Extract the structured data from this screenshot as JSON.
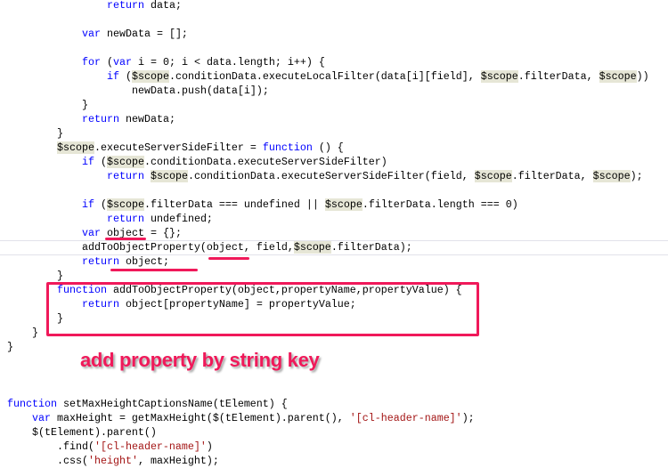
{
  "code_lines": [
    {
      "indent": 16,
      "text": "return data;"
    },
    {
      "indent": 0,
      "text": ""
    },
    {
      "indent": 12,
      "text": "var newData = [];"
    },
    {
      "indent": 0,
      "text": ""
    },
    {
      "indent": 12,
      "text": "for (var i = 0; i < data.length; i++) {"
    },
    {
      "indent": 16,
      "text": "if ($scope.conditionData.executeLocalFilter(data[i][field], $scope.filterData, $scope))"
    },
    {
      "indent": 20,
      "text": "newData.push(data[i]);"
    },
    {
      "indent": 12,
      "text": "}"
    },
    {
      "indent": 12,
      "text": "return newData;"
    },
    {
      "indent": 8,
      "text": "}"
    },
    {
      "indent": 8,
      "text": "$scope.executeServerSideFilter = function () {"
    },
    {
      "indent": 12,
      "text": "if ($scope.conditionData.executeServerSideFilter)"
    },
    {
      "indent": 16,
      "text": "return $scope.conditionData.executeServerSideFilter(field, $scope.filterData, $scope);"
    },
    {
      "indent": 0,
      "text": ""
    },
    {
      "indent": 12,
      "text": "if ($scope.filterData === undefined || $scope.filterData.length === 0)"
    },
    {
      "indent": 16,
      "text": "return undefined;"
    },
    {
      "indent": 12,
      "text": "var object = {};"
    },
    {
      "indent": 12,
      "text": "addToObjectProperty(object, field,$scope.filterData);"
    },
    {
      "indent": 12,
      "text": "return object;"
    },
    {
      "indent": 8,
      "text": "}"
    },
    {
      "indent": 8,
      "text": "function addToObjectProperty(object,propertyName,propertyValue) {"
    },
    {
      "indent": 12,
      "text": "return object[propertyName] = propertyValue;"
    },
    {
      "indent": 8,
      "text": "}"
    },
    {
      "indent": 4,
      "text": "}"
    },
    {
      "indent": 0,
      "text": "}"
    },
    {
      "indent": 0,
      "text": ""
    },
    {
      "indent": 0,
      "text": ""
    },
    {
      "indent": 0,
      "text": ""
    },
    {
      "indent": 0,
      "text": "function setMaxHeightCaptionsName(tElement) {"
    },
    {
      "indent": 4,
      "text": "var maxHeight = getMaxHeight($(tElement).parent(), '[cl-header-name]');"
    },
    {
      "indent": 4,
      "text": "$(tElement).parent()"
    },
    {
      "indent": 8,
      "text": ".find('[cl-header-name]')"
    },
    {
      "indent": 8,
      "text": ".css('height', maxHeight);"
    }
  ],
  "annotation": {
    "text": "add property by string key",
    "color": "#f0195a"
  },
  "colors": {
    "keyword": "#0000ff",
    "string": "#a31515",
    "highlight": "#e6e6d6"
  }
}
